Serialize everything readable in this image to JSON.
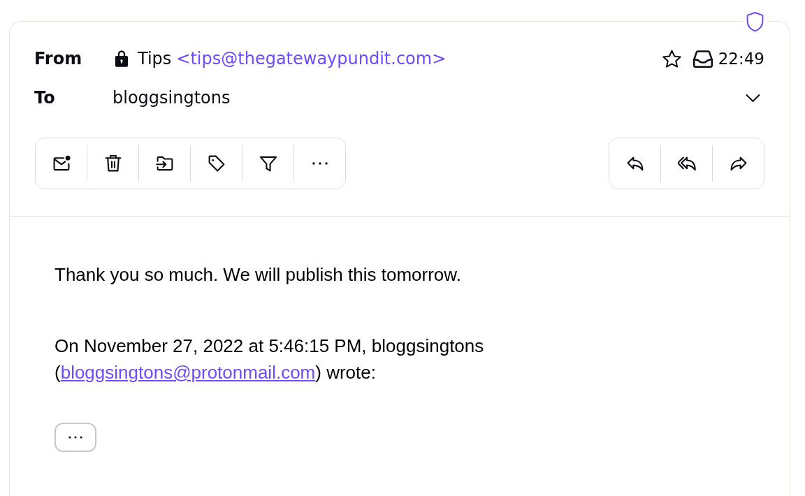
{
  "header": {
    "from": {
      "label": "From",
      "name": "Tips",
      "address": "<tips@thegatewaypundit.com>"
    },
    "to": {
      "label": "To",
      "recipient": "bloggsingtons"
    },
    "starred": false,
    "time": "22:49"
  },
  "toolbar": {
    "actions": [
      {
        "kind": "mark-unread"
      },
      {
        "kind": "trash"
      },
      {
        "kind": "move"
      },
      {
        "kind": "label"
      },
      {
        "kind": "filter"
      },
      {
        "kind": "more"
      }
    ],
    "reply_actions": [
      {
        "kind": "reply"
      },
      {
        "kind": "reply-all"
      },
      {
        "kind": "forward"
      }
    ]
  },
  "body": {
    "paragraphs": [
      "Thank you so much. We will publish this tomorrow."
    ],
    "attribution": {
      "before": "On November 27, 2022 at 5:46:15 PM, bloggsingtons (",
      "link": "bloggsingtons@protonmail.com",
      "after": ") wrote:"
    }
  }
}
